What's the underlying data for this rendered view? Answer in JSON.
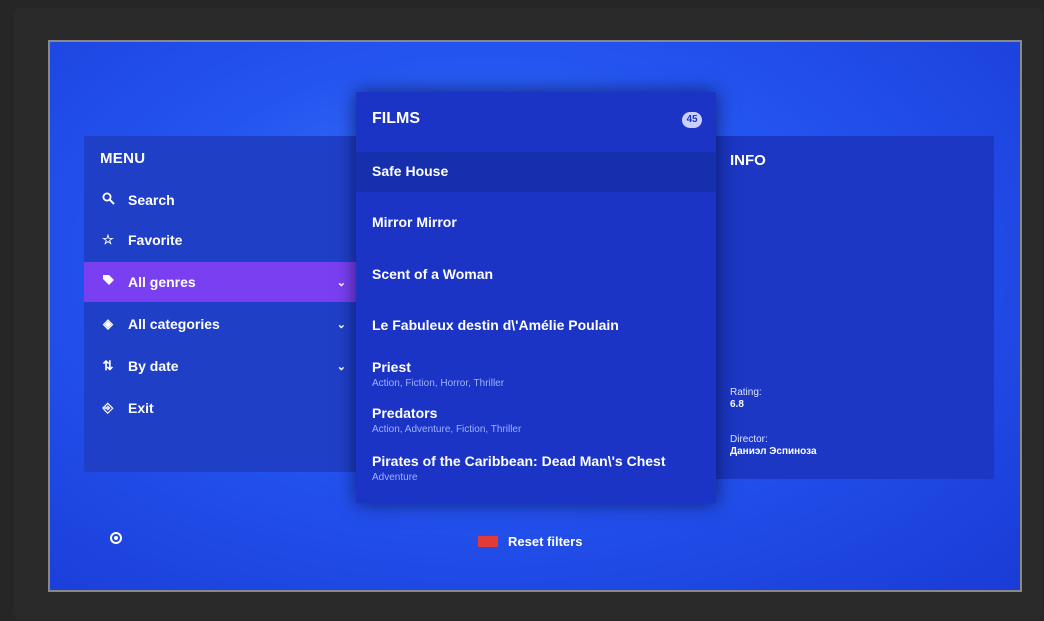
{
  "menu": {
    "title": "MENU",
    "items": [
      {
        "label": "Search",
        "icon": "search-icon"
      },
      {
        "label": "Favorite",
        "icon": "star-icon"
      },
      {
        "label": "All genres",
        "icon": "tag-icon",
        "active": true,
        "has_dropdown": true
      },
      {
        "label": "All categories",
        "icon": "categories-icon",
        "has_dropdown": true
      },
      {
        "label": "By date",
        "icon": "sort-icon",
        "has_dropdown": true
      },
      {
        "label": "Exit",
        "icon": "exit-icon"
      }
    ]
  },
  "films": {
    "title": "FILMS",
    "count": "45",
    "items": [
      {
        "name": "Safe House",
        "genres": ""
      },
      {
        "name": "Mirror Mirror",
        "genres": ""
      },
      {
        "name": "Scent of a Woman",
        "genres": ""
      },
      {
        "name": "Le Fabuleux destin d\\'Amélie Poulain",
        "genres": ""
      },
      {
        "name": "Priest",
        "genres": "Action, Fiction, Horror, Thriller"
      },
      {
        "name": "Predators",
        "genres": "Action, Adventure, Fiction, Thriller"
      },
      {
        "name": "Pirates of the Caribbean: Dead Man\\'s Chest",
        "genres": "Adventure"
      }
    ]
  },
  "info": {
    "title": "INFO",
    "rating_label": "Rating:",
    "rating_value": "6.8",
    "director_label": "Director:",
    "director_value": "Даниэл Эспиноза"
  },
  "footer": {
    "reset_label": "Reset filters"
  },
  "colors": {
    "accent_active": "#7a3ff0",
    "reset_key": "#e03a3a"
  }
}
